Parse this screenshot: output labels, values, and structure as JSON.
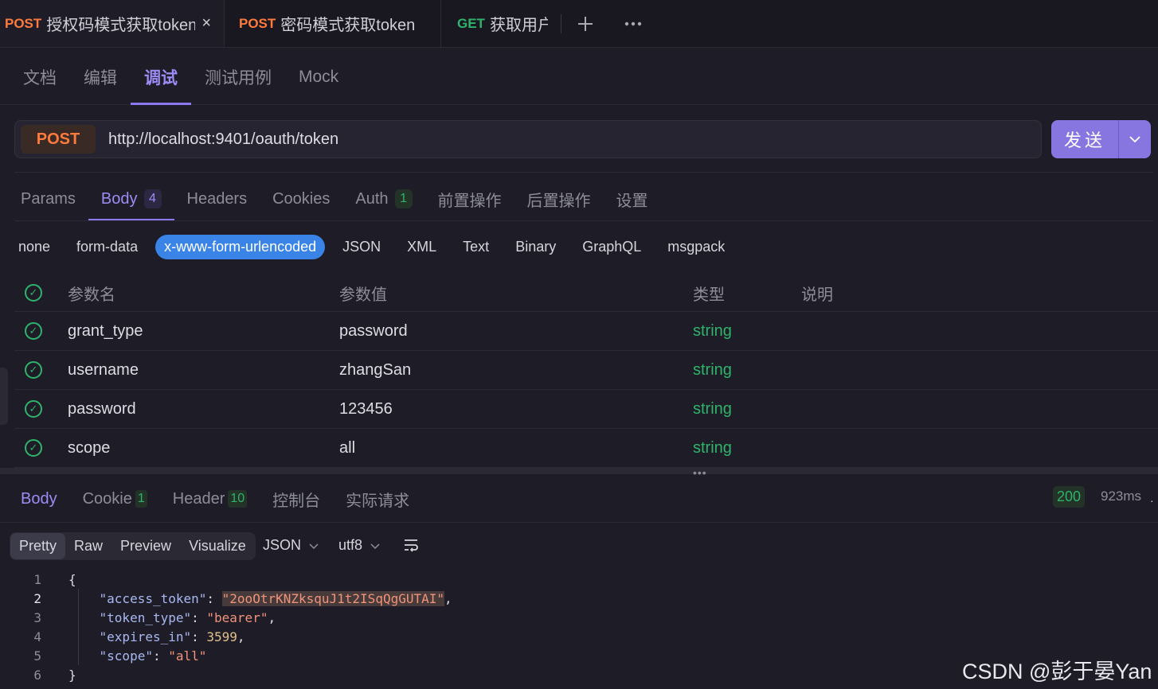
{
  "tabs": [
    {
      "method": "POST",
      "name": "授权码模式获取token",
      "close": "×"
    },
    {
      "method": "POST",
      "name": "密码模式获取token"
    },
    {
      "method": "GET",
      "name": "获取用户"
    }
  ],
  "tabbar": {
    "add_icon": "plus-icon",
    "more_icon": "ellipsis-icon"
  },
  "subnav": [
    "文档",
    "编辑",
    "调试",
    "测试用例",
    "Mock"
  ],
  "request": {
    "method": "POST",
    "url": "http://localhost:9401/oauth/token",
    "send_label": "发送"
  },
  "param_tabs": [
    {
      "label": "Params"
    },
    {
      "label": "Body",
      "badge": "4"
    },
    {
      "label": "Headers"
    },
    {
      "label": "Cookies"
    },
    {
      "label": "Auth",
      "badge": "1"
    },
    {
      "label": "前置操作"
    },
    {
      "label": "后置操作"
    },
    {
      "label": "设置"
    }
  ],
  "body_types": [
    "none",
    "form-data",
    "x-www-form-urlencoded",
    "JSON",
    "XML",
    "Text",
    "Binary",
    "GraphQL",
    "msgpack"
  ],
  "param_table": {
    "headers": [
      "参数名",
      "参数值",
      "类型",
      "说明"
    ],
    "rows": [
      {
        "name": "grant_type",
        "value": "password",
        "type": "string"
      },
      {
        "name": "username",
        "value": "zhangSan",
        "type": "string"
      },
      {
        "name": "password",
        "value": "123456",
        "type": "string"
      },
      {
        "name": "scope",
        "value": "all",
        "type": "string"
      }
    ]
  },
  "response_tabs": [
    {
      "label": "Body"
    },
    {
      "label": "Cookie",
      "badge": "1"
    },
    {
      "label": "Header",
      "badge": "10"
    },
    {
      "label": "控制台"
    },
    {
      "label": "实际请求"
    }
  ],
  "response_status": {
    "code": "200",
    "time": "923ms"
  },
  "view_modes": [
    "Pretty",
    "Raw",
    "Preview",
    "Visualize"
  ],
  "format": "JSON",
  "encoding": "utf8",
  "code_lines": [
    {
      "n": "1",
      "text": "{"
    },
    {
      "n": "2",
      "key": "\"access_token\"",
      "value": "\"2ooOtrKNZksquJ1t2ISqQgGUTAI\"",
      "tail": ","
    },
    {
      "n": "3",
      "key": "\"token_type\"",
      "value": "\"bearer\"",
      "tail": ","
    },
    {
      "n": "4",
      "key": "\"expires_in\"",
      "num": "3599",
      "tail": ","
    },
    {
      "n": "5",
      "key": "\"scope\"",
      "value": "\"all\"",
      "tail": ""
    },
    {
      "n": "6",
      "text": "}"
    }
  ],
  "watermark": "CSDN @彭于晏Yan",
  "colors": {
    "accent": "#8a78ee",
    "post": "#ff7a3d",
    "get": "#2fb36b",
    "send": "#8876e0",
    "active_pill": "#3a84e8"
  }
}
